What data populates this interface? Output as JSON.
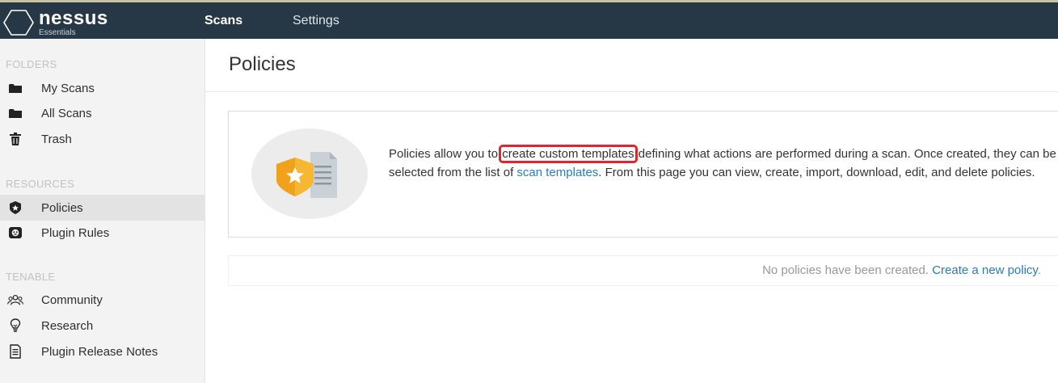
{
  "topbar": {
    "logo_name": "nessus",
    "logo_sub": "Essentials",
    "nav": {
      "scans": "Scans",
      "settings": "Settings"
    }
  },
  "sidebar": {
    "folders_title": "FOLDERS",
    "resources_title": "RESOURCES",
    "tenable_title": "TENABLE",
    "folders": [
      {
        "label": "My Scans",
        "icon": "folder-icon"
      },
      {
        "label": "All Scans",
        "icon": "folder-icon"
      },
      {
        "label": "Trash",
        "icon": "trash-icon"
      }
    ],
    "resources": [
      {
        "label": "Policies",
        "icon": "shield-star-icon",
        "active": true
      },
      {
        "label": "Plugin Rules",
        "icon": "plugin-rules-icon"
      }
    ],
    "tenable": [
      {
        "label": "Community",
        "icon": "community-icon"
      },
      {
        "label": "Research",
        "icon": "lightbulb-icon"
      },
      {
        "label": "Plugin Release Notes",
        "icon": "notes-icon"
      }
    ]
  },
  "main": {
    "title": "Policies",
    "info": {
      "text_1": "Policies allow you to ",
      "link_1": "create custom templates",
      "text_2": " defining what actions are performed during a scan. Once created, they can be selected from the list of ",
      "link_2": "scan templates",
      "text_3": ". From this page you can view, create, import, download, edit, and delete policies."
    },
    "empty": {
      "text": "No policies have been created. ",
      "link": "Create a new policy",
      "end": "."
    }
  },
  "colors": {
    "topbar": "#263746",
    "link": "#2b7bb8",
    "highlight": "#e0262b",
    "badge": "#f5a623"
  }
}
